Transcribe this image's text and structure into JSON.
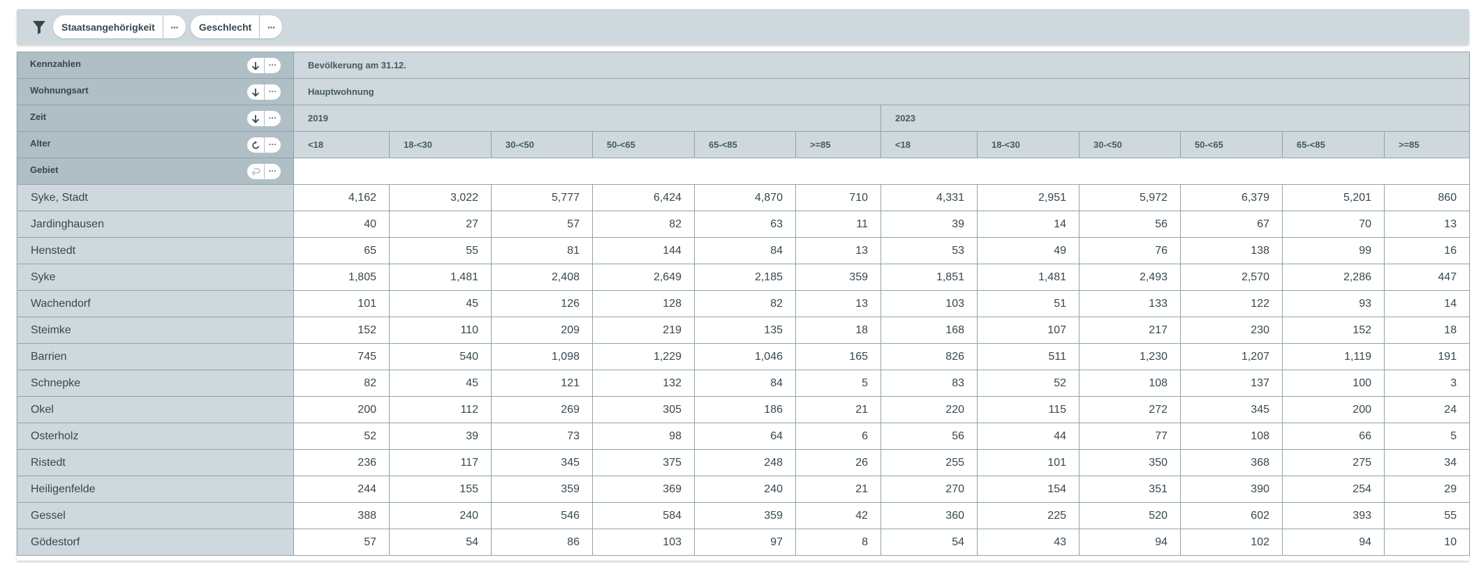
{
  "filters": [
    {
      "label": "Staatsangehörigkeit",
      "more": "···"
    },
    {
      "label": "Geschlecht",
      "more": "···"
    }
  ],
  "dims": {
    "kennzahlen": {
      "label": "Kennzahlen",
      "value": "Bevölkerung am 31.12."
    },
    "wohnungsart": {
      "label": "Wohnungsart",
      "value": "Hauptwohnung"
    },
    "zeit": {
      "label": "Zeit",
      "years": [
        "2019",
        "2023"
      ]
    },
    "alter": {
      "label": "Alter",
      "groups": [
        "<18",
        "18-<30",
        "30-<50",
        "50-<65",
        "65-<85",
        ">=85"
      ]
    },
    "gebiet": {
      "label": "Gebiet"
    }
  },
  "more_glyph": "···",
  "rows": [
    {
      "name": "Syke, Stadt",
      "values": [
        "4,162",
        "3,022",
        "5,777",
        "6,424",
        "4,870",
        "710",
        "4,331",
        "2,951",
        "5,972",
        "6,379",
        "5,201",
        "860"
      ]
    },
    {
      "name": "Jardinghausen",
      "values": [
        "40",
        "27",
        "57",
        "82",
        "63",
        "11",
        "39",
        "14",
        "56",
        "67",
        "70",
        "13"
      ]
    },
    {
      "name": "Henstedt",
      "values": [
        "65",
        "55",
        "81",
        "144",
        "84",
        "13",
        "53",
        "49",
        "76",
        "138",
        "99",
        "16"
      ]
    },
    {
      "name": "Syke",
      "values": [
        "1,805",
        "1,481",
        "2,408",
        "2,649",
        "2,185",
        "359",
        "1,851",
        "1,481",
        "2,493",
        "2,570",
        "2,286",
        "447"
      ]
    },
    {
      "name": "Wachendorf",
      "values": [
        "101",
        "45",
        "126",
        "128",
        "82",
        "13",
        "103",
        "51",
        "133",
        "122",
        "93",
        "14"
      ]
    },
    {
      "name": "Steimke",
      "values": [
        "152",
        "110",
        "209",
        "219",
        "135",
        "18",
        "168",
        "107",
        "217",
        "230",
        "152",
        "18"
      ]
    },
    {
      "name": "Barrien",
      "values": [
        "745",
        "540",
        "1,098",
        "1,229",
        "1,046",
        "165",
        "826",
        "511",
        "1,230",
        "1,207",
        "1,119",
        "191"
      ]
    },
    {
      "name": "Schnepke",
      "values": [
        "82",
        "45",
        "121",
        "132",
        "84",
        "5",
        "83",
        "52",
        "108",
        "137",
        "100",
        "3"
      ]
    },
    {
      "name": "Okel",
      "values": [
        "200",
        "112",
        "269",
        "305",
        "186",
        "21",
        "220",
        "115",
        "272",
        "345",
        "200",
        "24"
      ]
    },
    {
      "name": "Osterholz",
      "values": [
        "52",
        "39",
        "73",
        "98",
        "64",
        "6",
        "56",
        "44",
        "77",
        "108",
        "66",
        "5"
      ]
    },
    {
      "name": "Ristedt",
      "values": [
        "236",
        "117",
        "345",
        "375",
        "248",
        "26",
        "255",
        "101",
        "350",
        "368",
        "275",
        "34"
      ]
    },
    {
      "name": "Heiligenfelde",
      "values": [
        "244",
        "155",
        "359",
        "369",
        "240",
        "21",
        "270",
        "154",
        "351",
        "390",
        "254",
        "29"
      ]
    },
    {
      "name": "Gessel",
      "values": [
        "388",
        "240",
        "546",
        "584",
        "359",
        "42",
        "360",
        "225",
        "520",
        "602",
        "393",
        "55"
      ]
    },
    {
      "name": "Gödestorf",
      "values": [
        "57",
        "54",
        "86",
        "103",
        "97",
        "8",
        "54",
        "43",
        "94",
        "102",
        "94",
        "10"
      ]
    }
  ]
}
